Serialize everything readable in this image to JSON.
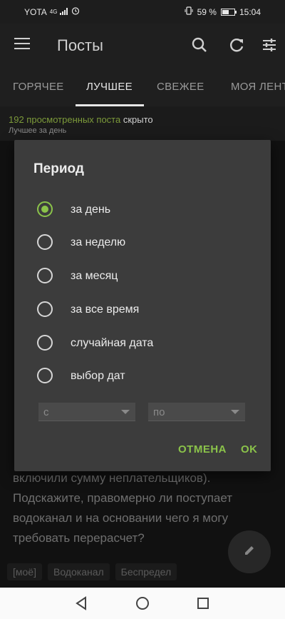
{
  "status": {
    "carrier": "YOTA",
    "network": "4G",
    "battery": "59 %",
    "battery_level": 0.59,
    "time": "15:04"
  },
  "appbar": {
    "title": "Посты"
  },
  "tabs": [
    "ГОРЯЧЕЕ",
    "ЛУЧШЕЕ",
    "СВЕЖЕЕ",
    "МОЯ ЛЕНТ"
  ],
  "info": {
    "count": "192 просмотренных поста",
    "hidden": " скрыто",
    "sub": "Лучшее за день"
  },
  "post": {
    "lines": [
      "включили сумму неплательщиков).",
      "Подскажите, правомерно ли поступает",
      "водоканал и на основании чего я могу",
      "требовать перерасчет?"
    ],
    "tags": [
      "[моё]",
      "Водоканал",
      "Беспредел"
    ]
  },
  "dialog": {
    "title": "Период",
    "options": [
      "за день",
      "за неделю",
      "за месяц",
      "за все время",
      "случайная дата",
      "выбор дат"
    ],
    "selected_index": 0,
    "from_placeholder": "с",
    "to_placeholder": "по",
    "cancel": "ОТМЕНА",
    "ok": "OK"
  },
  "colors": {
    "accent": "#8bc34a",
    "count": "#7c9a3a"
  }
}
